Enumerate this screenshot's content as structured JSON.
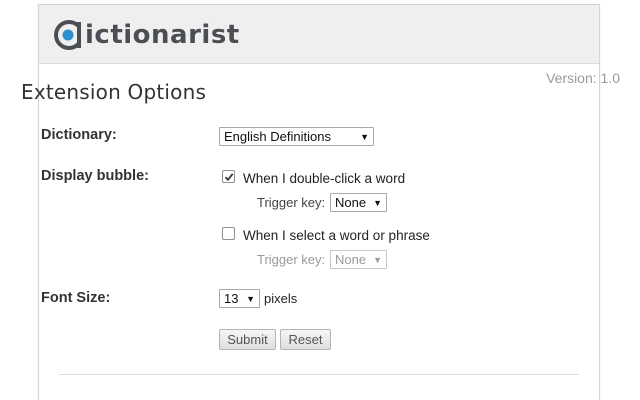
{
  "header": {
    "logo_text": "ictionarist",
    "logo_full": "Dictionarist"
  },
  "version_text": "Version: 1.0",
  "page_title": "Extension Options",
  "dictionary": {
    "label": "Dictionary:",
    "selected": "English Definitions"
  },
  "display_bubble": {
    "label": "Display bubble:",
    "option1": {
      "text": "When I double-click a word",
      "checked": true,
      "trigger_label": "Trigger key:",
      "trigger_value": "None"
    },
    "option2": {
      "text": "When I select a word or phrase",
      "checked": false,
      "trigger_label": "Trigger key:",
      "trigger_value": "None"
    }
  },
  "font_size": {
    "label": "Font Size:",
    "selected": "13",
    "unit": "pixels"
  },
  "buttons": {
    "submit": "Submit",
    "reset": "Reset"
  },
  "colors": {
    "logo_accent": "#2f8fce",
    "logo_text": "#4b4f54"
  },
  "icons": [
    "logo-mark-icon",
    "checkmark-icon",
    "dropdown-caret-icon"
  ]
}
